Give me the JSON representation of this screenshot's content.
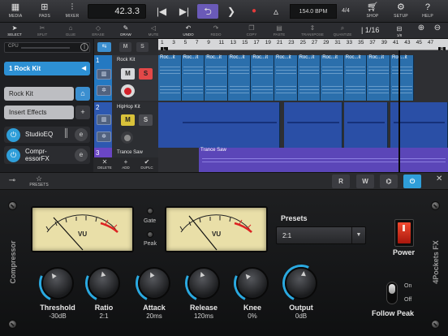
{
  "transport": {
    "media": "MEDIA",
    "pads": "PADS",
    "mixer": "MIXER",
    "position": "42.3.3",
    "bpm": "154.0 BPM",
    "signature": "4/4",
    "shop": "SHOP",
    "setup": "SETUP",
    "help": "HELP"
  },
  "tools": {
    "select": "SELECT",
    "split": "SPLIT",
    "glue": "GLUE",
    "erase": "ERASE",
    "draw": "DRAW",
    "mute": "MUTE",
    "undo": "UNDO",
    "redo": "REDO",
    "copy": "COPY",
    "paste": "PASTE",
    "transpose": "TRANSPOSE",
    "quantize": "QUANTIZE",
    "grid_value": "1/16",
    "grid_sub": "1/8"
  },
  "inspector": {
    "cpu_label": "CPU",
    "track_name": "1 Rock Kit",
    "instrument": "Rock Kit",
    "insert_effects": "Insert Effects",
    "effects": [
      "StudioEQ",
      "Compr-essorFX"
    ]
  },
  "tracks": [
    {
      "num": "1",
      "name": "Rock Kit"
    },
    {
      "num": "2",
      "name": "HipHop Kit"
    },
    {
      "num": "3",
      "name": "Trance Saw"
    }
  ],
  "ruler": [
    "1",
    "3",
    "5",
    "7",
    "9",
    "11",
    "13",
    "15",
    "17",
    "19",
    "21",
    "23",
    "25",
    "27",
    "29",
    "31",
    "33",
    "35",
    "37",
    "39",
    "41",
    "43",
    "45",
    "47"
  ],
  "clips": {
    "rock": [
      "Roc...it",
      "Roc...it",
      "Roc...it",
      "Roc...it",
      "Roc...it",
      "Roc...it",
      "Roc...it",
      "Roc...it",
      "Roc...it",
      "Roc...it",
      "Roc...it"
    ],
    "trance": "Trance Saw"
  },
  "track_controls": {
    "delete": "DELETE",
    "add": "ADD",
    "duplicate": "DUPLC"
  },
  "plugin_bar": {
    "presets_tab": "PRESETS"
  },
  "compressor": {
    "side_label_left": "Compressor",
    "side_label_right": "4Pockets FX",
    "meter_label": "VU",
    "gate": "Gate",
    "peak": "Peak",
    "presets_label": "Presets",
    "preset_value": "2:1",
    "power": "Power",
    "follow_on": "On",
    "follow_off": "Off",
    "follow_peak": "Follow Peak",
    "knobs": [
      {
        "name": "Threshold",
        "value": "-30dB"
      },
      {
        "name": "Ratio",
        "value": "2:1"
      },
      {
        "name": "Attack",
        "value": "20ms"
      },
      {
        "name": "Release",
        "value": "120ms"
      },
      {
        "name": "Knee",
        "value": "0%"
      },
      {
        "name": "Output",
        "value": "0dB"
      }
    ]
  }
}
